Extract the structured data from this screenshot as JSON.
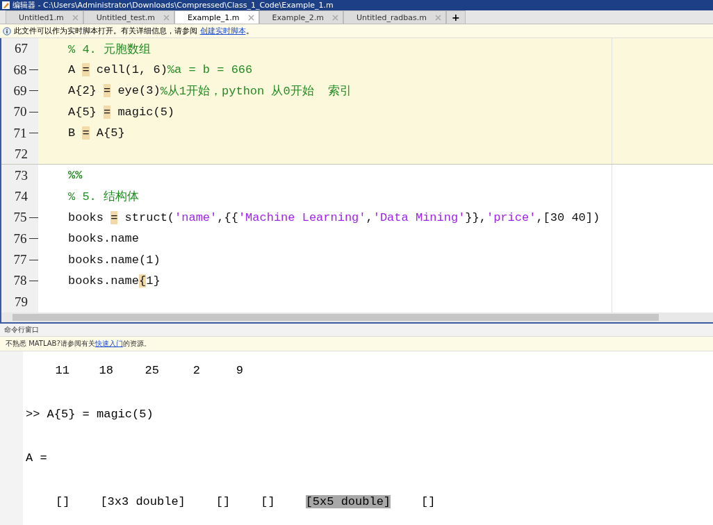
{
  "window": {
    "title": "编辑器 - C:\\Users\\Administrator\\Downloads\\Compressed\\Class_1_Code\\Example_1.m"
  },
  "tabs": [
    {
      "label": "Untitled1.m",
      "selected": false
    },
    {
      "label": "Untitled_test.m",
      "selected": false
    },
    {
      "label": "Example_1.m",
      "selected": true
    },
    {
      "label": "Example_2.m",
      "selected": false
    },
    {
      "label": "Untitled_radbas.m",
      "selected": false
    }
  ],
  "new_tab": "+",
  "editor_notice": {
    "text": "此文件可以作为实时脚本打开。有关详细信息，请参阅 ",
    "link": "创建实时脚本",
    "end": "。"
  },
  "editor_lines": [
    {
      "number": "67",
      "executable": false,
      "in_cell": true,
      "tokens": [
        {
          "kind": "comment",
          "text": "% 4. 元胞数组"
        }
      ]
    },
    {
      "number": "68",
      "executable": true,
      "in_cell": true,
      "tokens": [
        {
          "kind": "code",
          "text": "A "
        },
        {
          "kind": "mark",
          "text": "="
        },
        {
          "kind": "code",
          "text": " cell(1, 6)"
        },
        {
          "kind": "comment",
          "text": "%a = b = 666"
        }
      ]
    },
    {
      "number": "69",
      "executable": true,
      "in_cell": true,
      "tokens": [
        {
          "kind": "code",
          "text": "A{2} "
        },
        {
          "kind": "mark",
          "text": "="
        },
        {
          "kind": "code",
          "text": " eye(3)"
        },
        {
          "kind": "comment",
          "text": "%从1开始，python 从0开始  索引"
        }
      ]
    },
    {
      "number": "70",
      "executable": true,
      "in_cell": true,
      "tokens": [
        {
          "kind": "code",
          "text": "A{5} "
        },
        {
          "kind": "mark",
          "text": "="
        },
        {
          "kind": "code",
          "text": " magic(5)"
        }
      ]
    },
    {
      "number": "71",
      "executable": true,
      "in_cell": true,
      "tokens": [
        {
          "kind": "code",
          "text": "B "
        },
        {
          "kind": "mark",
          "text": "="
        },
        {
          "kind": "code",
          "text": " A{5}"
        }
      ]
    },
    {
      "number": "72",
      "executable": false,
      "in_cell": true
    },
    {
      "number": "73",
      "executable": false,
      "in_cell": false,
      "tokens": [
        {
          "kind": "cell",
          "text": "%%"
        }
      ]
    },
    {
      "number": "74",
      "executable": false,
      "in_cell": false,
      "tokens": [
        {
          "kind": "comment",
          "text": "% 5. 结构体"
        }
      ]
    },
    {
      "number": "75",
      "executable": true,
      "in_cell": false,
      "tokens": [
        {
          "kind": "code",
          "text": "books "
        },
        {
          "kind": "mark",
          "text": "="
        },
        {
          "kind": "code",
          "text": " struct("
        },
        {
          "kind": "string",
          "text": "'name'"
        },
        {
          "kind": "code",
          "text": ",{{"
        },
        {
          "kind": "string",
          "text": "'Machine Learning'"
        },
        {
          "kind": "code",
          "text": ","
        },
        {
          "kind": "string",
          "text": "'Data Mining'"
        },
        {
          "kind": "code",
          "text": "}},"
        },
        {
          "kind": "string",
          "text": "'price'"
        },
        {
          "kind": "code",
          "text": ",[30 40])"
        }
      ]
    },
    {
      "number": "76",
      "executable": true,
      "in_cell": false,
      "tokens": [
        {
          "kind": "code",
          "text": "books.name"
        }
      ]
    },
    {
      "number": "77",
      "executable": true,
      "in_cell": false,
      "tokens": [
        {
          "kind": "code",
          "text": "books.name(1)"
        }
      ]
    },
    {
      "number": "78",
      "executable": true,
      "in_cell": false,
      "tokens": [
        {
          "kind": "code",
          "text": "books.name"
        },
        {
          "kind": "mark",
          "text": "{"
        },
        {
          "kind": "code",
          "text": "1}"
        }
      ]
    },
    {
      "number": "79",
      "executable": false,
      "in_cell": false
    }
  ],
  "command_window": {
    "title": "命令行窗口",
    "notice": {
      "text": "不熟悉 MATLAB?请参阅有关",
      "link": "快速入门",
      "end": "的资源。"
    },
    "matrix_row": [
      "11",
      "18",
      "25",
      "2",
      "9"
    ],
    "command": ">> A{5} = magic(5)",
    "result_label": "A =",
    "cells": [
      {
        "text": "[]",
        "selected": false
      },
      {
        "text": "[3x3 double]",
        "selected": false
      },
      {
        "text": "[]",
        "selected": false
      },
      {
        "text": "[]",
        "selected": false
      },
      {
        "text": "[5x5 double]",
        "selected": true
      },
      {
        "text": "[]",
        "selected": false
      }
    ]
  }
}
